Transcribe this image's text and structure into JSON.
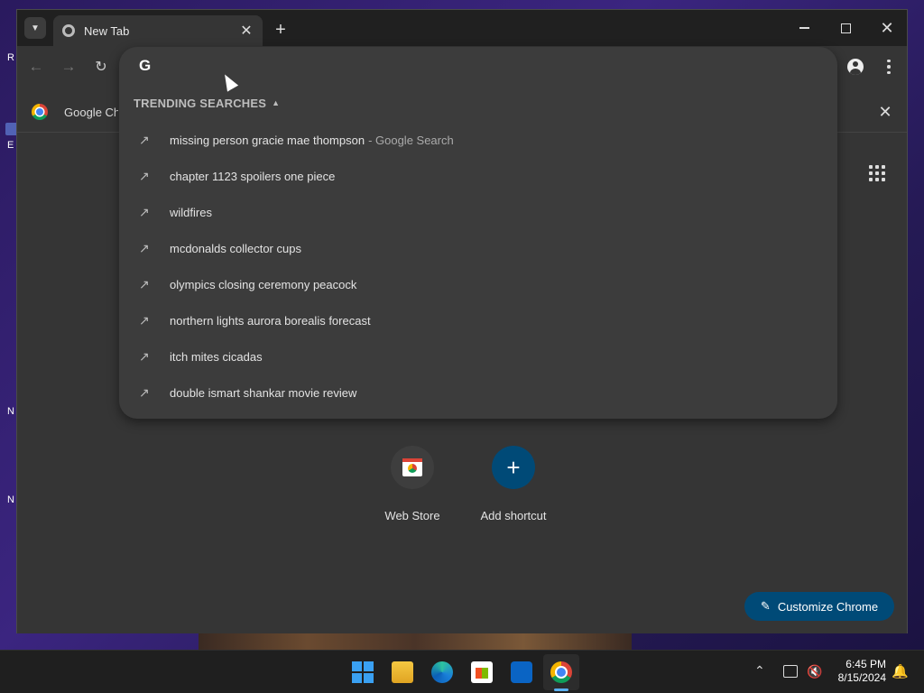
{
  "desktop": {
    "labels": [
      "R",
      "E",
      "N",
      "N"
    ]
  },
  "browser": {
    "tab": {
      "title": "New Tab"
    },
    "infobar": {
      "text": "Google Ch"
    },
    "omnibox": {
      "logo": "G",
      "section_header": "TRENDING SEARCHES",
      "suggestions": [
        {
          "text": "missing person gracie mae thompson",
          "suffix": "- Google Search"
        },
        {
          "text": "chapter 1123 spoilers one piece",
          "suffix": ""
        },
        {
          "text": "wildfires",
          "suffix": ""
        },
        {
          "text": "mcdonalds collector cups",
          "suffix": ""
        },
        {
          "text": "olympics closing ceremony peacock",
          "suffix": ""
        },
        {
          "text": "northern lights aurora borealis forecast",
          "suffix": ""
        },
        {
          "text": "itch mites cicadas",
          "suffix": ""
        },
        {
          "text": "double ismart shankar movie review",
          "suffix": ""
        }
      ]
    },
    "shortcuts": [
      {
        "label": "Web Store"
      },
      {
        "label": "Add shortcut"
      }
    ],
    "customize_label": "Customize Chrome"
  },
  "taskbar": {
    "time": "6:45 PM",
    "date": "8/15/2024"
  },
  "colors": {
    "accent": "#004a77",
    "window_bg": "#353535",
    "dropdown_bg": "#3c3c3c"
  }
}
